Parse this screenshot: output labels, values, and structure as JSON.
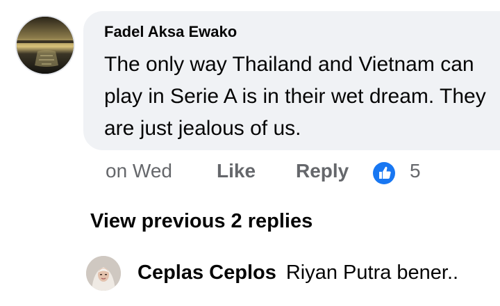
{
  "comment": {
    "author": "Fadel Aksa Ewako",
    "text": "The only way Thailand and Vietnam can play in Serie A is in their wet dream. They are just jealous of us.",
    "time": "on Wed",
    "like_label": "Like",
    "reply_label": "Reply",
    "reaction_icon": "thumbs-up-icon",
    "reaction_count": "5"
  },
  "replies": {
    "view_previous_label": "View previous 2 replies",
    "latest": {
      "author": "Ceplas Ceplos",
      "snippet": "Riyan Putra bener.."
    }
  },
  "colors": {
    "bubble": "#f0f2f5",
    "meta_text": "#65676b",
    "reaction_blue": "#1877f2"
  }
}
